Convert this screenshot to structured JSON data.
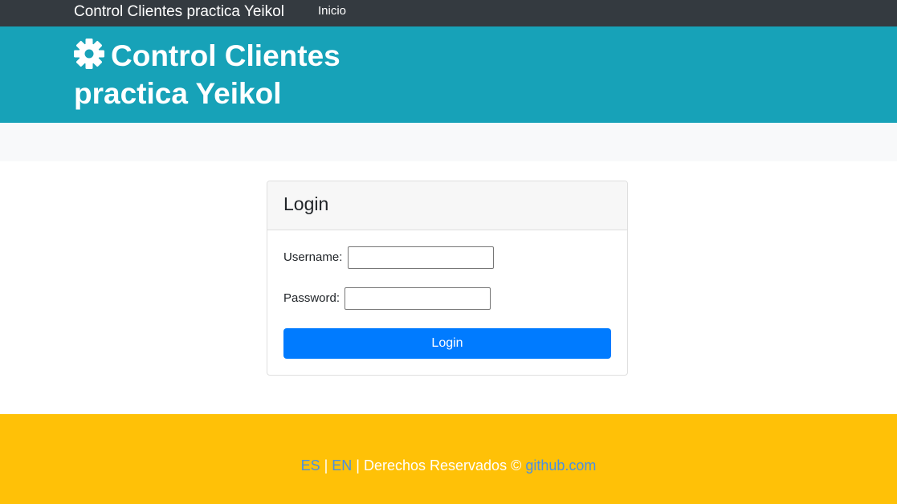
{
  "navbar": {
    "brand": "Control Clientes practica Yeikol",
    "links": [
      {
        "label": "Inicio"
      }
    ]
  },
  "hero": {
    "icon": "gear-icon",
    "title": "Control Clientes practica Yeikol"
  },
  "login_card": {
    "header": "Login",
    "username_label": "Username:",
    "username_value": "",
    "password_label": "Password:",
    "password_value": "",
    "submit_label": "Login"
  },
  "footer": {
    "lang_es": "ES",
    "separator1": " | ",
    "lang_en": "EN",
    "separator2": " | ",
    "rights_text": "Derechos Reservados © ",
    "site_link": "github.com"
  },
  "colors": {
    "navbar_bg": "#343a40",
    "hero_bg": "#17a2b8",
    "strip_bg": "#f8f9fa",
    "primary": "#007bff",
    "footer_bg": "#ffc107",
    "link": "#4a90e2"
  }
}
